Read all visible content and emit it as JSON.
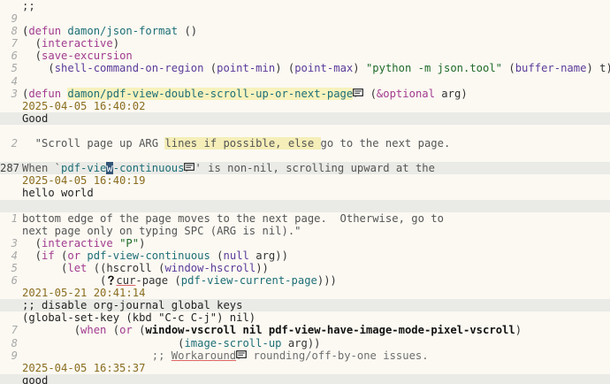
{
  "editor": {
    "lines": [
      {
        "ln": "",
        "text": ";;"
      },
      {
        "ln": "9",
        "text": ""
      },
      {
        "ln": "8",
        "parts": [
          {
            "t": "(",
            "c": "pr"
          },
          {
            "t": "defun",
            "c": "kw"
          },
          {
            "t": " "
          },
          {
            "t": "damon/json-format",
            "c": "fn"
          },
          {
            "t": " ()"
          }
        ]
      },
      {
        "ln": "7",
        "parts": [
          {
            "t": "  ("
          },
          {
            "t": "interactive",
            "c": "kw"
          },
          {
            "t": ")"
          }
        ]
      },
      {
        "ln": "6",
        "parts": [
          {
            "t": "  ("
          },
          {
            "t": "save-excursion",
            "c": "kw"
          }
        ]
      },
      {
        "ln": "5",
        "parts": [
          {
            "t": "    ("
          },
          {
            "t": "shell-command-on-region",
            "c": "bi"
          },
          {
            "t": " ("
          },
          {
            "t": "point-min",
            "c": "bi"
          },
          {
            "t": ") ("
          },
          {
            "t": "point-max",
            "c": "bi"
          },
          {
            "t": ") "
          },
          {
            "t": "\"python -m json.tool\"",
            "c": "str"
          },
          {
            "t": " ("
          },
          {
            "t": "buffer-name",
            "c": "bi"
          },
          {
            "t": ") t)))"
          }
        ]
      },
      {
        "ln": "4",
        "text": ""
      },
      {
        "ln": "3",
        "parts": [
          {
            "t": "("
          },
          {
            "t": "defun",
            "c": "kw"
          },
          {
            "t": " "
          },
          {
            "t": "damon/pdf-view-double-scroll-up-or-next-page",
            "c": "fn hl-yellow"
          },
          {
            "icon": "note"
          },
          {
            "t": " ("
          },
          {
            "t": "&optional",
            "c": "kw"
          },
          {
            "t": " arg)"
          }
        ]
      },
      {
        "ln": "",
        "t": "note-date",
        "text": "2025-04-05 16:40:02"
      },
      {
        "ln": "",
        "t": "note-text",
        "text": "Good",
        "band": true
      },
      {
        "ln": "",
        "text": ""
      },
      {
        "ln": "2",
        "parts": [
          {
            "t": "  \"Scroll page up ARG ",
            "c": "doc"
          },
          {
            "t": "lines if possible, else ",
            "c": "doc hl-word"
          },
          {
            "t": "go to the next page.",
            "c": "doc"
          }
        ]
      },
      {
        "ln": "",
        "text": ""
      },
      {
        "ln": "287",
        "current": true,
        "band": true,
        "parts": [
          {
            "t": "When `",
            "c": "doc"
          },
          {
            "t": "pdf-vie",
            "c": "fn"
          },
          {
            "t": "w",
            "c": "cursor"
          },
          {
            "t": "-continuous",
            "c": "fn"
          },
          {
            "icon": "note"
          },
          {
            "t": "' is non-nil, scrolling upward at the",
            "c": "doc"
          }
        ]
      },
      {
        "ln": "",
        "t": "note-date",
        "text": "2025-04-05 16:40:19"
      },
      {
        "ln": "",
        "t": "note-text",
        "text": "hello world"
      },
      {
        "ln": "",
        "text": "",
        "band": true
      },
      {
        "ln": "1",
        "parts": [
          {
            "t": "bottom edge of the page moves to the next page.  Otherwise, go to",
            "c": "doc"
          }
        ]
      },
      {
        "ln": "",
        "parts": [
          {
            "t": "next page only on typing SPC (ARG is nil).\"",
            "c": "doc"
          }
        ]
      },
      {
        "ln": "3",
        "parts": [
          {
            "t": "  ("
          },
          {
            "t": "interactive",
            "c": "kw"
          },
          {
            "t": " "
          },
          {
            "t": "\"P\"",
            "c": "str"
          },
          {
            "t": ")"
          }
        ]
      },
      {
        "ln": "4",
        "parts": [
          {
            "t": "  ("
          },
          {
            "t": "if",
            "c": "kw"
          },
          {
            "t": " ("
          },
          {
            "t": "or",
            "c": "kw"
          },
          {
            "t": " "
          },
          {
            "t": "pdf-view-continuous",
            "c": "fn"
          },
          {
            "t": " ("
          },
          {
            "t": "null",
            "c": "bi"
          },
          {
            "t": " arg))"
          }
        ]
      },
      {
        "ln": "5",
        "parts": [
          {
            "t": "      ("
          },
          {
            "t": "let",
            "c": "kw"
          },
          {
            "t": " ((hscroll ("
          },
          {
            "t": "window-hscroll",
            "c": "bi"
          },
          {
            "t": "))"
          }
        ]
      },
      {
        "ln": "6",
        "parts": [
          {
            "t": "            ("
          },
          {
            "icon": "question"
          },
          {
            "t": "cur",
            "c": "mark"
          },
          {
            "t": "-page ("
          },
          {
            "t": "pdf-view-current-page",
            "c": "fn"
          },
          {
            "t": ")))"
          }
        ]
      },
      {
        "ln": "",
        "t": "note-date",
        "text": "2021-05-21 20:41:14"
      },
      {
        "ln": "",
        "t": "note-text",
        "text": ";; disable org-journal global keys",
        "band": true
      },
      {
        "ln": "",
        "t": "note-text",
        "text": "(global-set-key (kbd \"C-c C-j\") nil)"
      },
      {
        "ln": "7",
        "parts": [
          {
            "t": "        ("
          },
          {
            "t": "when",
            "c": "kw"
          },
          {
            "t": " ("
          },
          {
            "t": "or",
            "c": "kw"
          },
          {
            "t": " ("
          },
          {
            "t": "window-vscroll nil pdf-view-have-image-mode-pixel-vscroll",
            "c": "strong"
          },
          {
            "t": ")"
          }
        ]
      },
      {
        "ln": "8",
        "parts": [
          {
            "t": "                        ("
          },
          {
            "t": "image-scroll-up",
            "c": "fn"
          },
          {
            "t": " arg))"
          }
        ]
      },
      {
        "ln": "9",
        "parts": [
          {
            "t": "                    ;; ",
            "c": "comment"
          },
          {
            "t": "Workaround",
            "c": "comment mark"
          },
          {
            "icon": "note"
          },
          {
            "t": " rounding/off-by-one issues.",
            "c": "comment"
          }
        ]
      },
      {
        "ln": "",
        "t": "note-date",
        "text": "2025-04-05 16:35:37"
      },
      {
        "ln": "",
        "t": "note-text",
        "text": "good",
        "band": true
      }
    ]
  }
}
